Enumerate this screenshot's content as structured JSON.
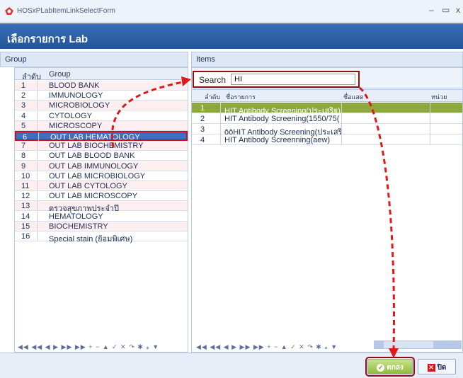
{
  "window": {
    "title": "HOSxPLabItemLinkSelectForm",
    "minimize": "–",
    "maximize": "▭",
    "close": "x"
  },
  "header": {
    "title": "เลือกรายการ Lab"
  },
  "left_panel": {
    "title": "Group",
    "columns": [
      "ลำดับ",
      "Group"
    ],
    "rows": [
      {
        "no": "1",
        "name": "BLOOD BANK"
      },
      {
        "no": "2",
        "name": "IMMUNOLOGY"
      },
      {
        "no": "3",
        "name": "MICROBIOLOGY"
      },
      {
        "no": "4",
        "name": "CYTOLOGY"
      },
      {
        "no": "5",
        "name": "MICROSCOPY"
      },
      {
        "no": "6",
        "name": "OUT LAB HEMATOLOGY"
      },
      {
        "no": "7",
        "name": "OUT LAB BIOCHEMISTRY"
      },
      {
        "no": "8",
        "name": "OUT LAB BLOOD BANK"
      },
      {
        "no": "9",
        "name": "OUT LAB IMMUNOLOGY"
      },
      {
        "no": "10",
        "name": "OUT LAB MICROBIOLOGY"
      },
      {
        "no": "11",
        "name": "OUT LAB CYTOLOGY"
      },
      {
        "no": "12",
        "name": "OUT LAB MICROSCOPY"
      },
      {
        "no": "13",
        "name": "ตรวจสุขภาพประจำปี"
      },
      {
        "no": "14",
        "name": "HEMATOLOGY"
      },
      {
        "no": "15",
        "name": "BIOCHEMISTRY"
      },
      {
        "no": "16",
        "name": "Special stain (ย้อมพิเศษ)"
      }
    ],
    "nav": "◀◀ ◀◀ ◀ ▶ ▶▶ ▶▶ + − ▲ ✓ ✕ ↷ ✱ ⁎ ▼"
  },
  "right_panel": {
    "title": "Items",
    "search": {
      "label": "Search",
      "value": "HI"
    },
    "columns": [
      "ลำดับ",
      "ชื่อรายการ",
      "ชื่อแสด",
      "หน่วย"
    ],
    "rows": [
      {
        "no": "1",
        "name": "HIT Antibody Screening(ประเสริฐ)"
      },
      {
        "no": "2",
        "name": "HIT Antibody Screening(1550/75("
      },
      {
        "no": "3",
        "name": "ôôHIT Antibody Screening(ประเสริ"
      },
      {
        "no": "4",
        "name": "HIT Antibody Screenning(aew)"
      }
    ],
    "nav": "◀◀ ◀◀ ◀ ▶ ▶▶ ▶▶ + − ▲ ✓ ✕ ↷ ✱ ⁎ ▼"
  },
  "footer": {
    "ok": "ตกลง",
    "cancel": "ปิด"
  }
}
